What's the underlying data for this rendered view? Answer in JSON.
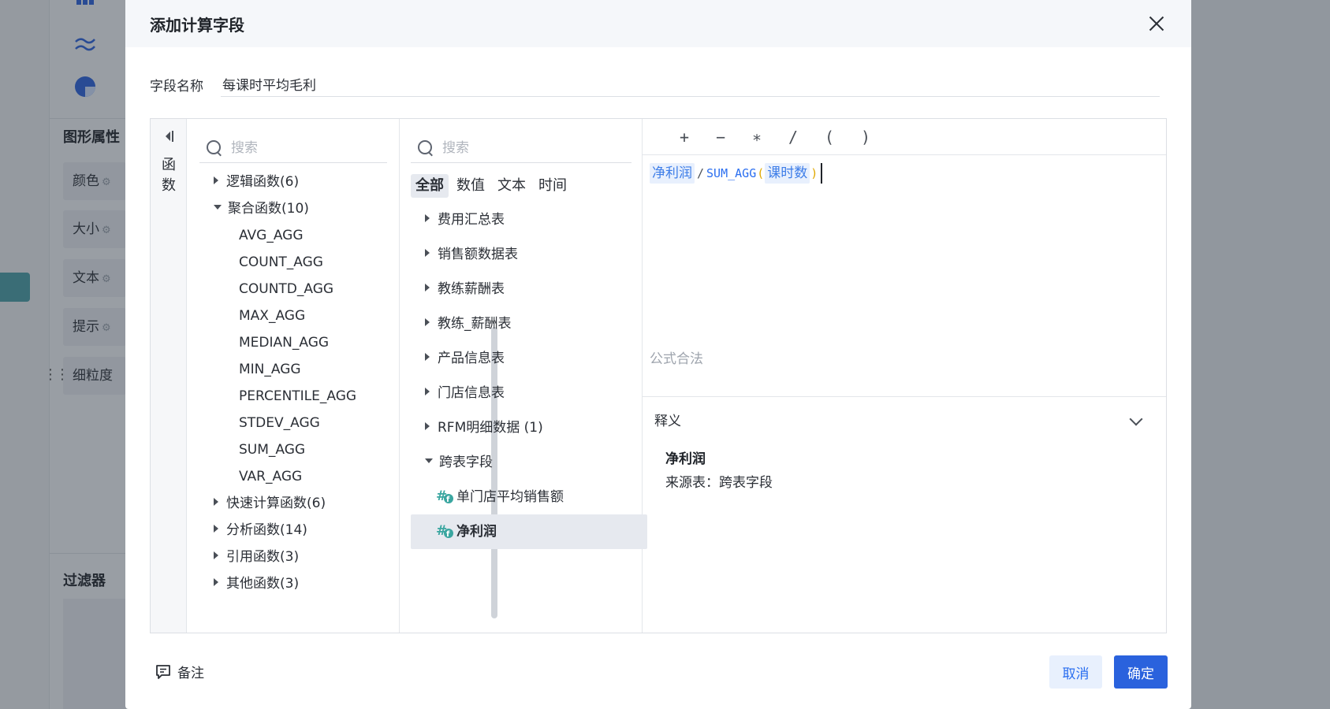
{
  "background": {
    "section_shape": "图形属性",
    "props": [
      "颜色",
      "大小",
      "文本",
      "提示",
      "细粒度"
    ],
    "section_filter": "过滤器"
  },
  "dialog": {
    "title": "添加计算字段",
    "name_label": "字段名称",
    "name_value": "每课时平均毛利",
    "rail_label": "函数",
    "fn_search_placeholder": "搜索",
    "fn_groups": [
      {
        "label": "逻辑函数(6)",
        "expanded": false
      },
      {
        "label": "聚合函数(10)",
        "expanded": true
      },
      {
        "label": "快速计算函数(6)",
        "expanded": false
      },
      {
        "label": "分析函数(14)",
        "expanded": false
      },
      {
        "label": "引用函数(3)",
        "expanded": false
      },
      {
        "label": "其他函数(3)",
        "expanded": false
      }
    ],
    "agg_functions": [
      "AVG_AGG",
      "COUNT_AGG",
      "COUNTD_AGG",
      "MAX_AGG",
      "MEDIAN_AGG",
      "MIN_AGG",
      "PERCENTILE_AGG",
      "STDEV_AGG",
      "SUM_AGG",
      "VAR_AGG"
    ],
    "field_search_placeholder": "搜索",
    "field_tabs": [
      "全部",
      "数值",
      "文本",
      "时间"
    ],
    "active_field_tab": "全部",
    "tables": [
      "费用汇总表",
      "销售额数据表",
      "教练薪酬表",
      "教练_薪酬表",
      "产品信息表",
      "门店信息表",
      "RFM明细数据 (1)",
      "跨表字段"
    ],
    "cross_fields": [
      "单门店平均销售额",
      "净利润"
    ],
    "selected_field": "净利润",
    "operators": [
      "+",
      "−",
      "∗",
      "/",
      "(",
      ")"
    ],
    "formula": {
      "field1": "净利润",
      "op": "/",
      "func": "SUM_AGG",
      "open": "(",
      "field2": "课时数",
      "close": ")"
    },
    "validation": "公式合法",
    "explain_title": "释义",
    "explain_name": "净利润",
    "explain_source": "来源表：跨表字段",
    "note_label": "备注",
    "cancel_label": "取消",
    "ok_label": "确定"
  },
  "colors": {
    "primary": "#2a62dd",
    "token_bg": "#e8f0fd",
    "paren": "#e0a800",
    "calc_icon": "#3aa6a0"
  }
}
